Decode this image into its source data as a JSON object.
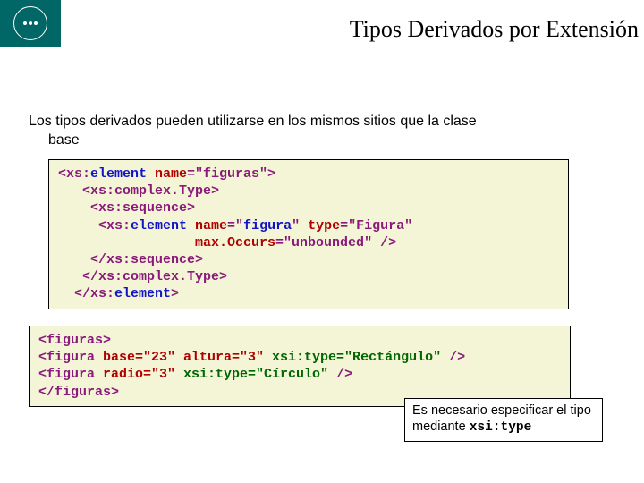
{
  "title": "Tipos Derivados por Extensión",
  "desc_line1": "Los tipos derivados pueden utilizarse en los mismos sitios que la clase",
  "desc_line2": "base",
  "schema": {
    "l1a": "<xs:",
    "l1b": "element",
    "l1c": " name",
    "l1d": "=\"figuras\">",
    "l2": "   <xs:complex.Type>",
    "l3": "    <xs:sequence>",
    "l4a": "     <xs:",
    "l4b": "element",
    "l4c": " name",
    "l4d": "=\"",
    "l4e": "figura",
    "l4f": "\" ",
    "l4g": "type",
    "l4h": "=\"Figura\"",
    "l5a": "                 max.Occurs",
    "l5b": "=\"unbounded\" />",
    "l6": "    </xs:sequence>",
    "l7": "   </xs:complex.Type>",
    "l8a": "  </xs:",
    "l8b": "element",
    "l8c": ">"
  },
  "xml": {
    "l1": "<figuras>",
    "l2a": "<figura ",
    "l2b": "base=\"23\" altura=\"3\" ",
    "l2c": "xsi:type=\"Rectángulo\"",
    "l2d": " />",
    "l3a": "<figura ",
    "l3b": "radio=\"3\" ",
    "l3c": "xsi:type=\"Círculo\"",
    "l3d": " />",
    "l4": "</figuras>"
  },
  "note_text": "Es necesario especificar el tipo mediante ",
  "note_code": "xsi:type"
}
